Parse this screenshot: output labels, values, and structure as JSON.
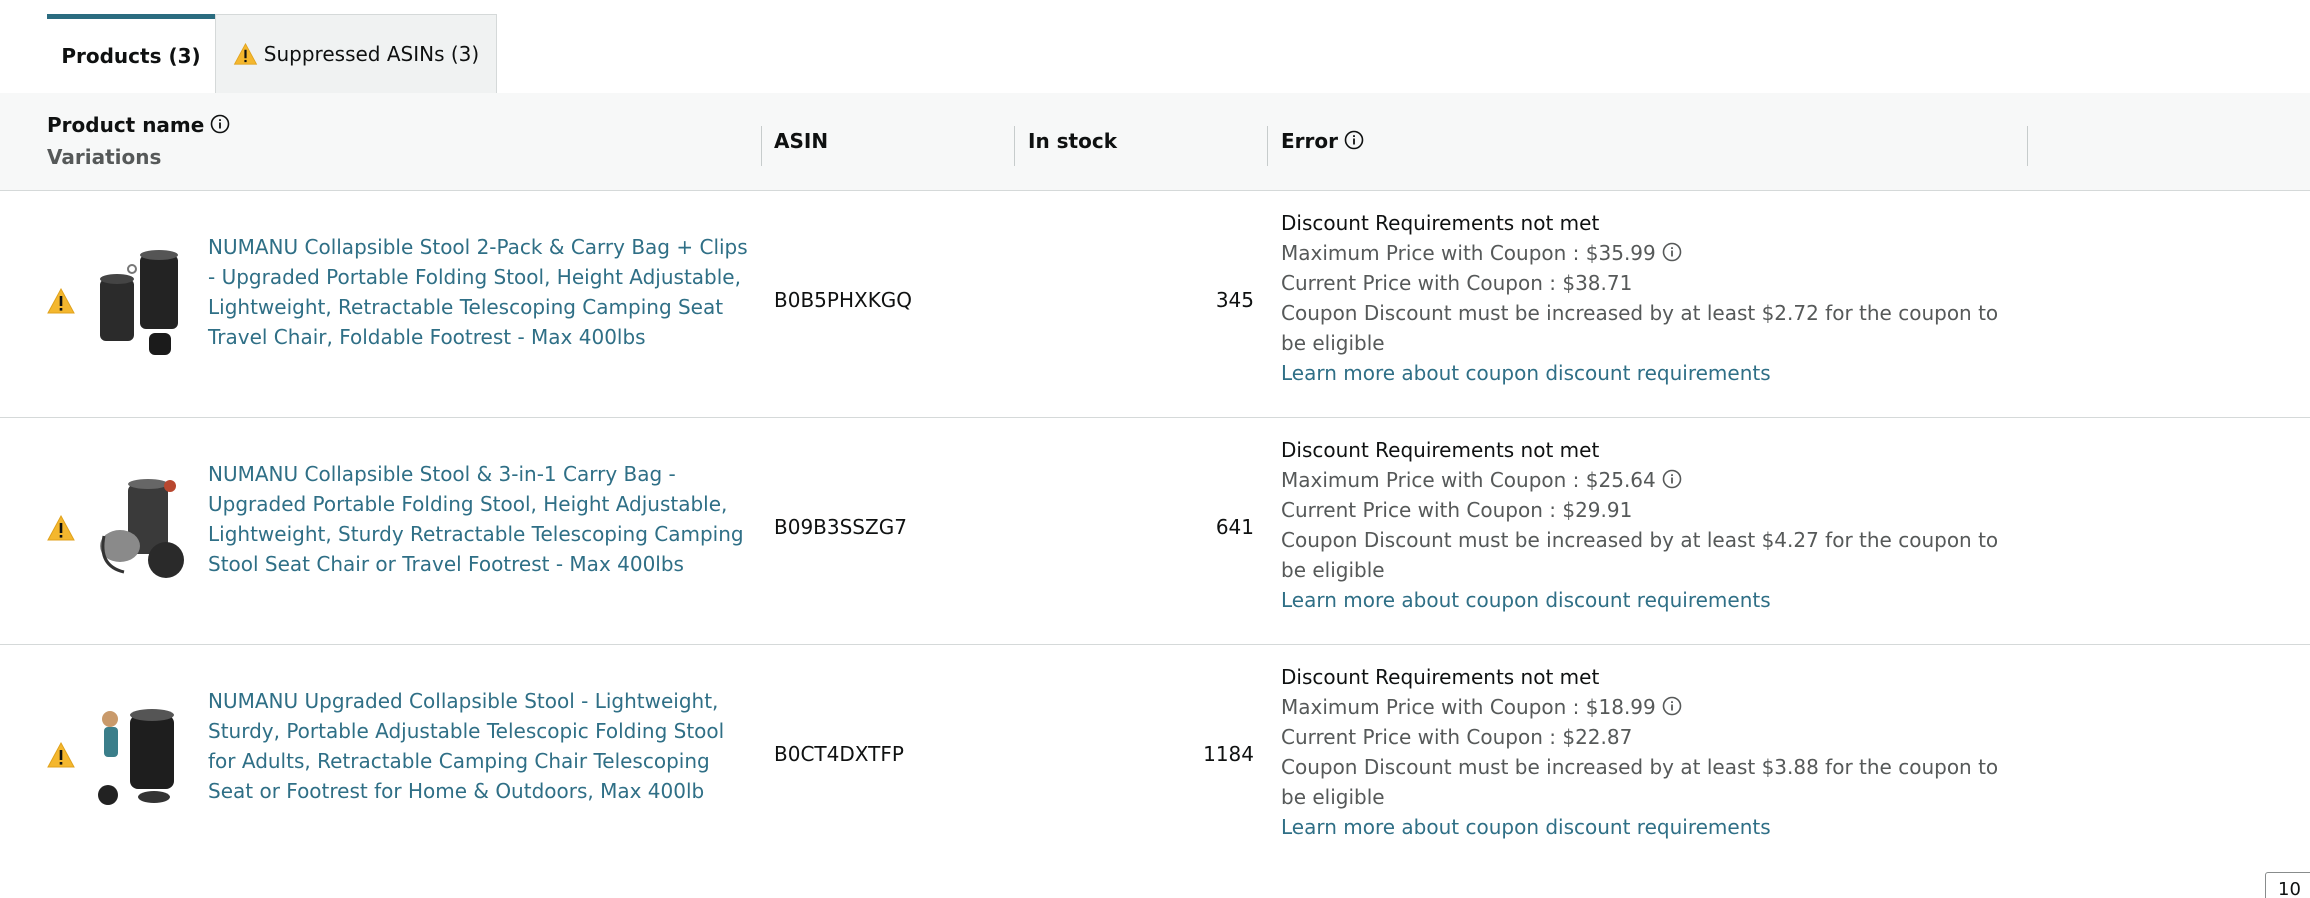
{
  "tabs": [
    {
      "label": "Products (3)"
    },
    {
      "label": "Suppressed ASINs (3)",
      "icon": "warning-icon"
    }
  ],
  "table": {
    "headers": {
      "product_name": "Product name",
      "variations": "Variations",
      "asin": "ASIN",
      "in_stock": "In stock",
      "error": "Error"
    },
    "rows": [
      {
        "name": "NUMANU Collapsible Stool 2-Pack & Carry Bag + Clips - Upgraded Portable Folding Stool, Height Adjustable, Lightweight, Retractable Telescoping Camping Seat Travel Chair, Foldable Footrest - Max 400lbs",
        "asin": "B0B5PHXKGQ",
        "stock": "345",
        "error_title": "Discount Requirements not met",
        "max_price": "Maximum Price with Coupon : $35.99",
        "current_price": "Current Price with Coupon : $38.71",
        "increase_msg": "Coupon Discount must be increased by at least $2.72 for the coupon to be eligible",
        "learn_more": "Learn more about coupon discount requirements"
      },
      {
        "name": "NUMANU Collapsible Stool & 3-in-1 Carry Bag - Upgraded Portable Folding Stool, Height Adjustable, Lightweight, Sturdy Retractable Telescoping Camping Stool Seat Chair or Travel Footrest - Max 400lbs",
        "asin": "B09B3SSZG7",
        "stock": "641",
        "error_title": "Discount Requirements not met",
        "max_price": "Maximum Price with Coupon : $25.64",
        "current_price": "Current Price with Coupon : $29.91",
        "increase_msg": "Coupon Discount must be increased by at least $4.27 for the coupon to be eligible",
        "learn_more": "Learn more about coupon discount requirements"
      },
      {
        "name": "NUMANU Upgraded Collapsible Stool - Lightweight, Sturdy, Portable Adjustable Telescopic Folding Stool for Adults, Retractable Camping Chair Telescoping Seat or Footrest for Home & Outdoors, Max 400lb",
        "asin": "B0CT4DXTFP",
        "stock": "1184",
        "error_title": "Discount Requirements not met",
        "max_price": "Maximum Price with Coupon : $18.99",
        "current_price": "Current Price with Coupon : $22.87",
        "increase_msg": "Coupon Discount must be increased by at least $3.88 for the coupon to be eligible",
        "learn_more": "Learn more about coupon discount requirements"
      }
    ]
  },
  "pager": {
    "page_size": "10"
  },
  "colors": {
    "accent": "#2b6c80",
    "link": "#2f6f86",
    "warning": "#f4b72e"
  }
}
